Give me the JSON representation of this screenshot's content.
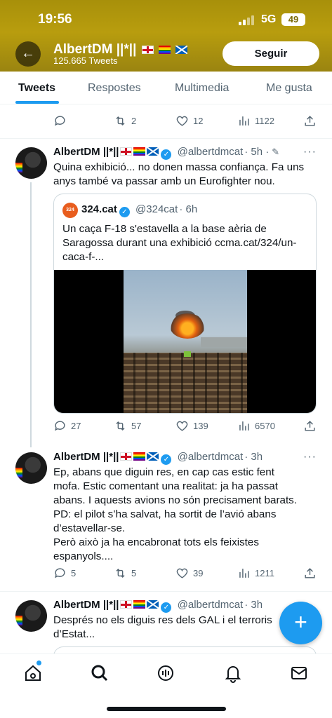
{
  "status": {
    "time": "19:56",
    "network": "5G",
    "battery": "49"
  },
  "header": {
    "name": "AlbertDM ||*||",
    "tweet_count": "125.665 Tweets",
    "follow_label": "Seguir",
    "back_icon": "arrow-left-icon"
  },
  "tabs": [
    {
      "label": "Tweets",
      "active": true
    },
    {
      "label": "Respostes",
      "active": false
    },
    {
      "label": "Multimedia",
      "active": false
    },
    {
      "label": "Me gusta",
      "active": false
    }
  ],
  "top_actions": {
    "replies": "",
    "retweets": "2",
    "likes": "12",
    "views": "1122"
  },
  "tweets": [
    {
      "name": "AlbertDM ||*||",
      "handle": "@albertdmcat",
      "time": "· 5h ·",
      "text": "Quina exhibició... no donen massa confiança. Fa uns anys també va passar amb un Eurofighter nou.",
      "quote": {
        "logo_text": "324",
        "name": "324.cat",
        "handle": "@324cat",
        "time": "· 6h",
        "text": "Un caça F-18 s'estavella a la base aèria de Saragossa durant una exhibició ccma.cat/324/un-caca-f-..."
      },
      "actions": {
        "replies": "27",
        "retweets": "57",
        "likes": "139",
        "views": "6570"
      }
    },
    {
      "name": "AlbertDM ||*||",
      "handle": "@albertdmcat",
      "time": "· 3h",
      "text_lines": [
        "Ep, abans que diguin res, en cap cas estic fent",
        "mofa. Estic comentant una realitat: ja ha passat",
        "abans. I aquests avions no són precisament barats.",
        "PD: el pilot s’ha salvat, ha sortit de l’avió abans",
        "d’estavellar-se.",
        "Però això ja ha encabronat tots els feixistes",
        "espanyols...."
      ],
      "actions": {
        "replies": "5",
        "retweets": "5",
        "likes": "39",
        "views": "1211"
      }
    },
    {
      "name": "AlbertDM ||*||",
      "handle": "@albertdmcat",
      "time": "· 3h",
      "text_lines": [
        "Després no els diguis res dels GAL i el terroris",
        "d’Estat..."
      ]
    }
  ],
  "fab_label": "+",
  "colors": {
    "accent": "#1d9bf0",
    "banner": "#b89d0e"
  }
}
